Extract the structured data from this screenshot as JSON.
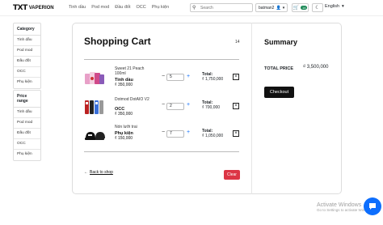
{
  "nav": {
    "logo_mark": "TXT",
    "brand": "VAPERION",
    "links": [
      "Tinh dầu",
      "Pod mod",
      "Đầu đốt",
      "OCC",
      "Phụ kiện"
    ],
    "search_placeholder": "Search",
    "user": "batman2",
    "cart_count": "14",
    "language": "English"
  },
  "sidebar": {
    "category_title": "Category",
    "categories": [
      "Tinh dầu",
      "Pod mod",
      "Đầu đốt",
      "OCC",
      "Phụ kiện"
    ],
    "price_title": "Price range",
    "price_items": [
      "Tinh dầu",
      "Pod mod",
      "Đầu đốt",
      "OCC",
      "Phụ kiện"
    ]
  },
  "cart": {
    "title": "Shopping Cart",
    "item_count": "14",
    "total_label": "Total:",
    "currency": "₫",
    "items": [
      {
        "name": "Sweet 21 Peach 100ml",
        "category": "Tinh dầu",
        "price": "350,000",
        "qty": "5",
        "total": "1,750,000"
      },
      {
        "name": "Dotmod DotAIO V2",
        "category": "OCC",
        "price": "350,000",
        "qty": "2",
        "total": "700,000"
      },
      {
        "name": "Nón lưỡi trai",
        "category": "Phụ kiện",
        "price": "150,000",
        "qty": "7",
        "total": "1,050,000"
      }
    ],
    "back_label": "Back to shop",
    "clear_label": "Clear"
  },
  "summary": {
    "title": "Summary",
    "total_price_label": "TOTAL PRICE",
    "total_price_value": "3,500,000",
    "checkout_label": "Checkout"
  },
  "watermark": {
    "line1": "Activate Windows",
    "line2": "Go to Settings to activate Windows."
  },
  "colors": {
    "primary": "#0d6efd",
    "danger": "#dc3545",
    "success": "#198754",
    "dark": "#111111"
  }
}
